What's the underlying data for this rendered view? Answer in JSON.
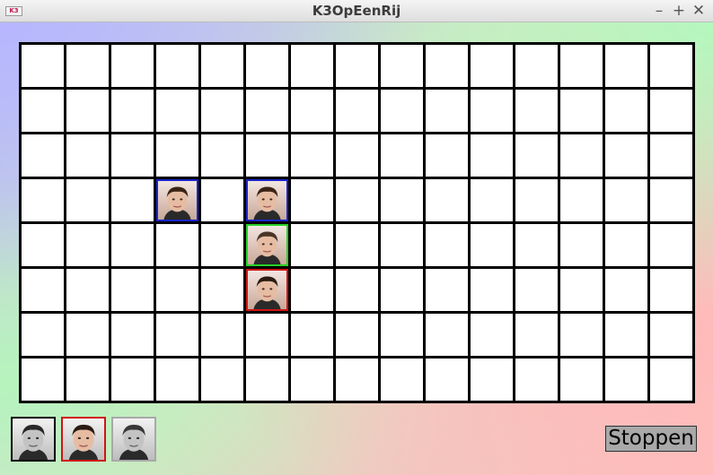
{
  "window": {
    "title": "K3OpEenRij",
    "app_icon_text": "K3",
    "minimize_glyph": "–",
    "maximize_glyph": "+",
    "close_glyph": "✕"
  },
  "board": {
    "columns": 15,
    "rows": 8,
    "pieces": [
      {
        "row": 3,
        "col": 3,
        "player": "blue",
        "icon": "player1-face-icon"
      },
      {
        "row": 3,
        "col": 5,
        "player": "blue",
        "icon": "player1-face-icon"
      },
      {
        "row": 4,
        "col": 5,
        "player": "green",
        "icon": "player3-face-icon"
      },
      {
        "row": 5,
        "col": 5,
        "player": "red",
        "icon": "player2-face-icon"
      }
    ]
  },
  "players": [
    {
      "id": "player1",
      "icon": "player1-face-icon",
      "border": "#000000",
      "active": false
    },
    {
      "id": "player2",
      "icon": "player2-face-icon",
      "border": "#d11414",
      "active": true
    },
    {
      "id": "player3",
      "icon": "player3-face-icon",
      "border": "#a8a8a8",
      "active": false
    }
  ],
  "colors": {
    "blue": "#1a24cc",
    "green": "#27d127",
    "red": "#d11414"
  },
  "buttons": {
    "stop_label": "Stoppen"
  }
}
